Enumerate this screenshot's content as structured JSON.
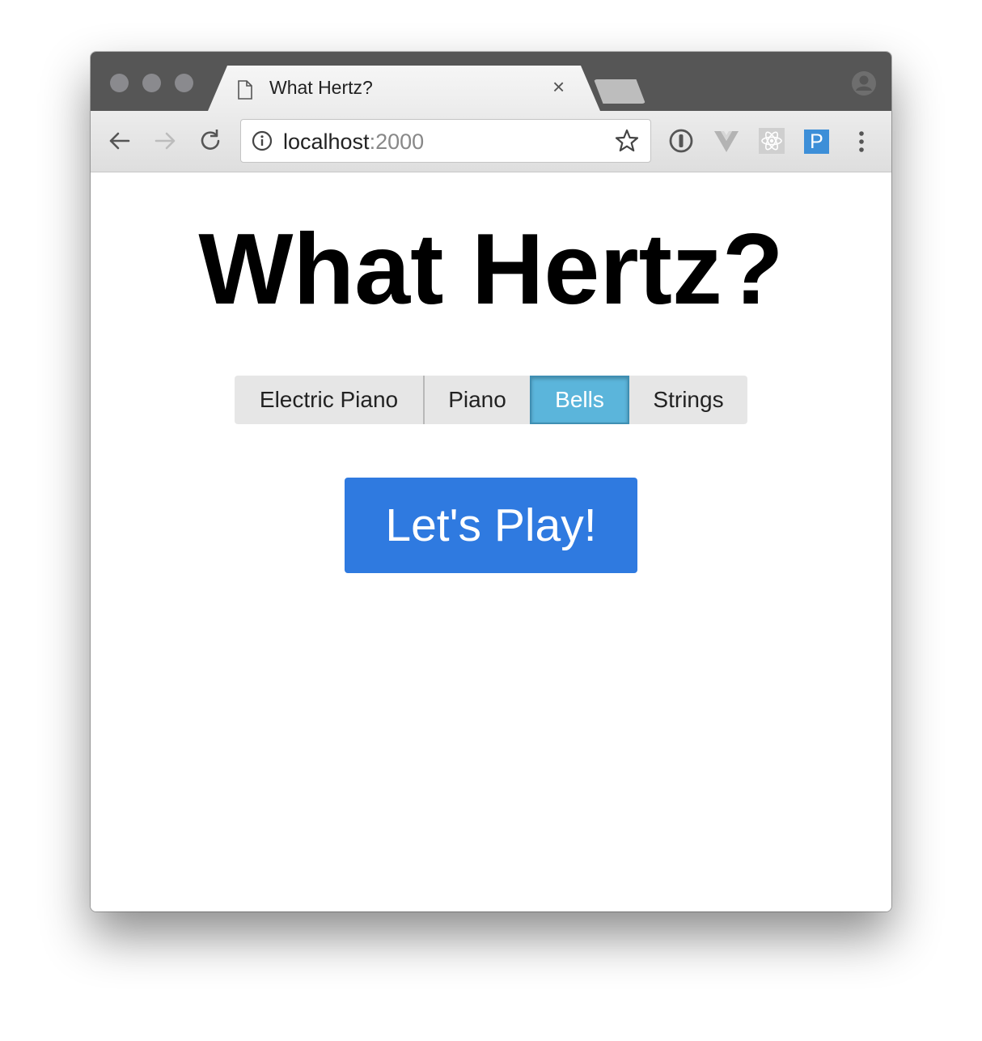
{
  "browser": {
    "tab_title": "What Hertz?",
    "tab_close": "×",
    "url_host": "localhost",
    "url_port": ":2000",
    "extension_p_label": "P",
    "icons": [
      "document-icon",
      "back-arrow-icon",
      "forward-arrow-icon",
      "reload-icon",
      "info-icon",
      "star-icon",
      "password-manager-icon",
      "vue-devtools-icon",
      "react-devtools-icon",
      "extension-p-icon",
      "menu-dots-icon",
      "profile-icon"
    ]
  },
  "page": {
    "title": "What Hertz?",
    "instruments": [
      "Electric Piano",
      "Piano",
      "Bells",
      "Strings"
    ],
    "selected_instrument": "Bells",
    "play_label": "Let's Play!"
  },
  "colors": {
    "play_button": "#2f7ae0",
    "selected_instrument": "#5bb5db",
    "instrument_bg": "#e6e6e6"
  }
}
